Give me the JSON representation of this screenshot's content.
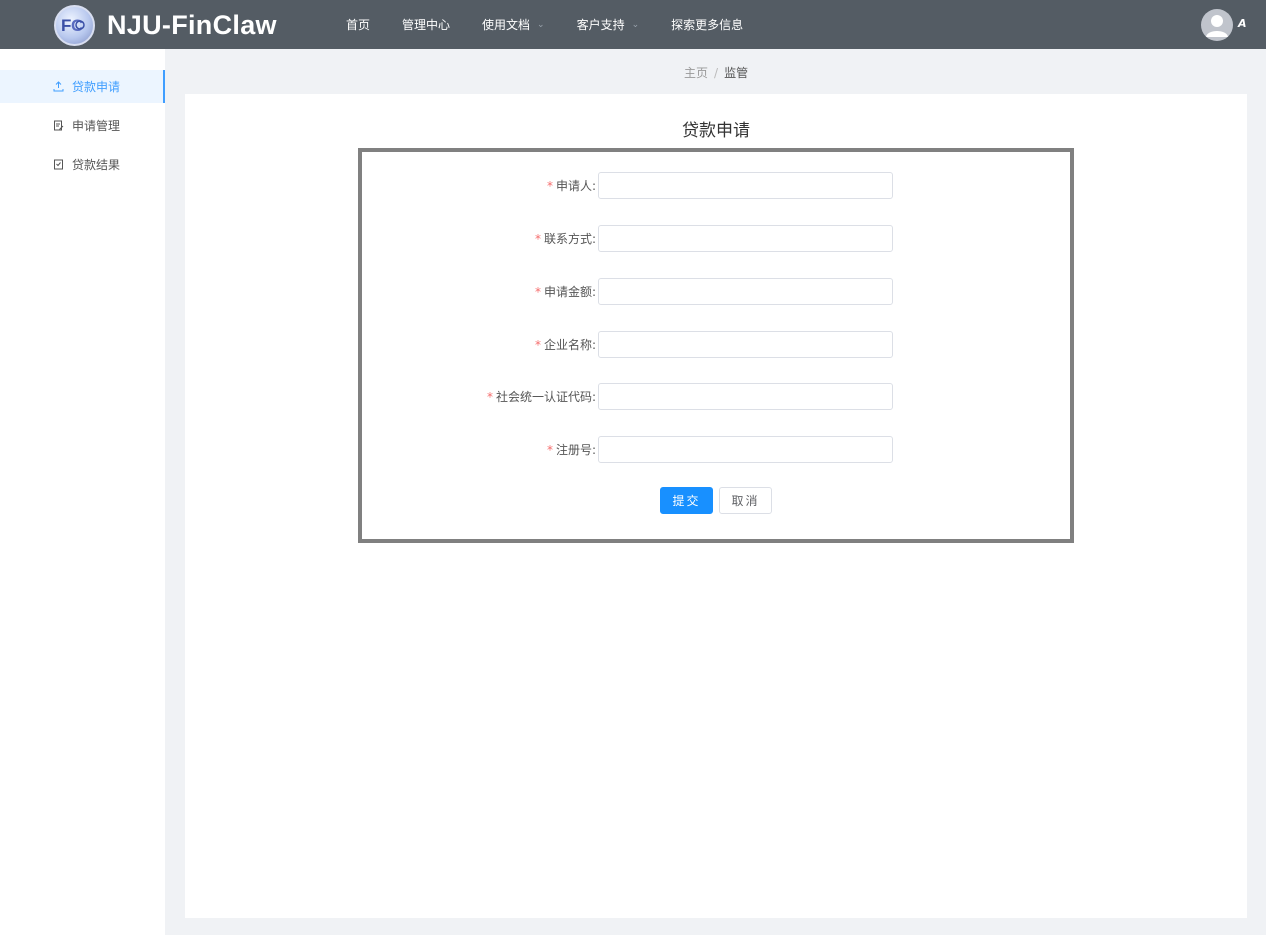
{
  "app": {
    "title": "NJU-FinClaw",
    "user_initial": "A"
  },
  "nav": {
    "items": [
      {
        "label": "首页",
        "has_dropdown": false
      },
      {
        "label": "管理中心",
        "has_dropdown": false
      },
      {
        "label": "使用文档",
        "has_dropdown": true
      },
      {
        "label": "客户支持",
        "has_dropdown": true
      },
      {
        "label": "探索更多信息",
        "has_dropdown": false
      }
    ]
  },
  "sidebar": {
    "items": [
      {
        "label": "贷款申请",
        "icon": "upload-icon",
        "active": true
      },
      {
        "label": "申请管理",
        "icon": "edit-document-icon",
        "active": false
      },
      {
        "label": "贷款结果",
        "icon": "result-document-icon",
        "active": false
      }
    ]
  },
  "breadcrumb": {
    "home": "主页",
    "separator": "/",
    "current": "监管"
  },
  "form": {
    "title": "贷款申请",
    "required_mark": "*",
    "fields": [
      {
        "label": "申请人:",
        "value": "",
        "placeholder": ""
      },
      {
        "label": "联系方式:",
        "value": "",
        "placeholder": ""
      },
      {
        "label": "申请金额:",
        "value": "",
        "placeholder": ""
      },
      {
        "label": "企业名称:",
        "value": "",
        "placeholder": ""
      },
      {
        "label": "社会统一认证代码:",
        "value": "",
        "placeholder": ""
      },
      {
        "label": "注册号:",
        "value": "",
        "placeholder": ""
      }
    ],
    "submit_label": "提交",
    "cancel_label": "取消"
  },
  "colors": {
    "header_bg": "#545c64",
    "accent": "#409eff",
    "primary_button": "#1890ff",
    "required": "#f56c6c"
  }
}
